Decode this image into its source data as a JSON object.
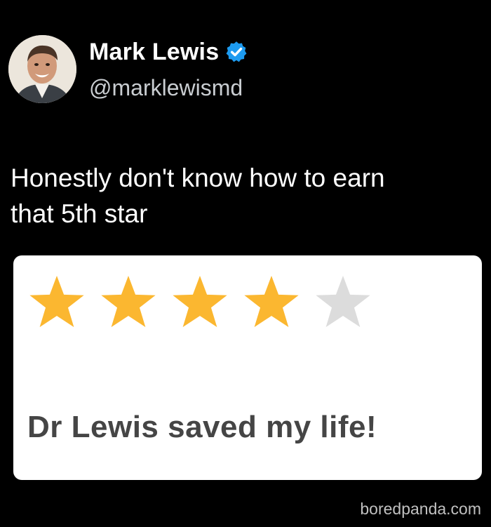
{
  "tweet": {
    "author_name": "Mark Lewis",
    "author_handle": "@marklewismd",
    "verified": true,
    "avatar_icon": "profile-photo",
    "text_line_1": "Honestly don't know how to earn",
    "text_line_2": "that 5th star"
  },
  "review": {
    "rating": 4,
    "max_rating": 5,
    "star_filled_color": "#fbb730",
    "star_empty_color": "#dcdcdc",
    "text": "Dr Lewis saved my life!"
  },
  "watermark": "boredpanda.com",
  "colors": {
    "background": "#000000",
    "verified_badge": "#1d9bf0"
  }
}
